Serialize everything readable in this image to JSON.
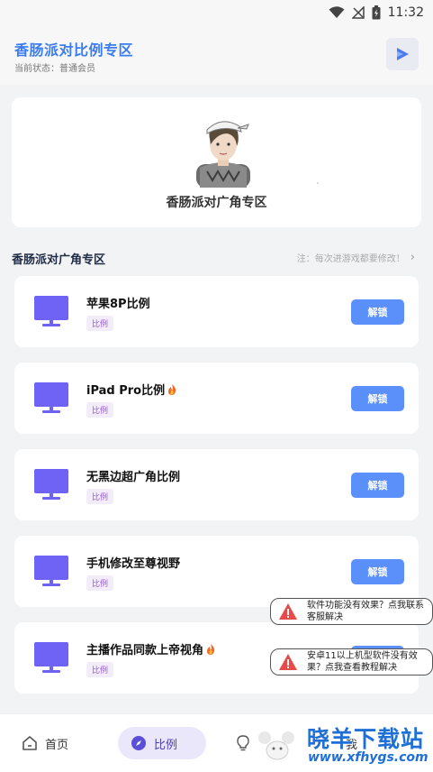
{
  "status_bar": {
    "time": "11:32",
    "icons": [
      "wifi-icon",
      "no-signal-icon",
      "battery-charging-icon"
    ]
  },
  "header": {
    "title": "香肠派对比例专区",
    "status_text": "当前状态：普通会员",
    "play_icon": "play-icon"
  },
  "hero": {
    "title": "香肠派对广角专区"
  },
  "section": {
    "title": "香肠派对广角专区",
    "note": "注：每次进游戏都要修改！"
  },
  "items": [
    {
      "title": "苹果8P比例",
      "tag": "比例",
      "button": "解锁",
      "fire": false
    },
    {
      "title": "iPad Pro比例",
      "tag": "比例",
      "button": "解锁",
      "fire": true
    },
    {
      "title": "无黑边超广角比例",
      "tag": "比例",
      "button": "解锁",
      "fire": false
    },
    {
      "title": "手机修改至尊视野",
      "tag": "比例",
      "button": "解锁",
      "fire": false
    },
    {
      "title": "主播作品同款上帝视角",
      "tag": "比例",
      "button": "解锁",
      "fire": true
    }
  ],
  "toasts": [
    {
      "text": "软件功能没有效果？点我联系客服解决"
    },
    {
      "text": "安卓11以上机型软件没有效果？点我查看教程解决"
    }
  ],
  "bottom_nav": {
    "home": "首页",
    "ratio": "比例",
    "mine_partial": "我"
  },
  "watermark": {
    "title": "晓羊下载站",
    "url": "www.xfhygs.com"
  },
  "colors": {
    "accent": "#3b7cf0",
    "button": "#5b8ff9",
    "monitor": "#6f63f5",
    "tag_text": "#9a5bd6",
    "warning": "#e84a4a"
  }
}
